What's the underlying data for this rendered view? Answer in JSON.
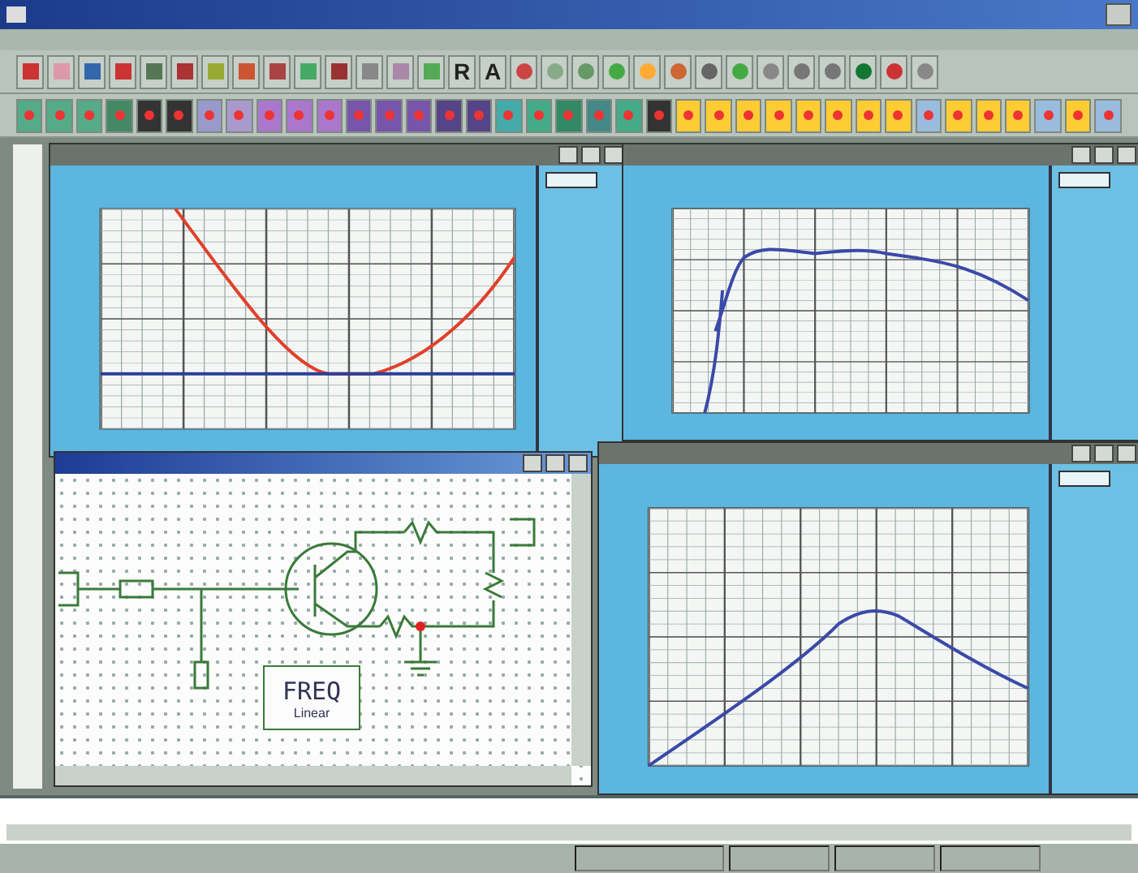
{
  "toolbar": {
    "letters": [
      {
        "label": "R"
      },
      {
        "label": "A"
      }
    ]
  },
  "windows": [
    {
      "kind": "graph",
      "active": false
    },
    {
      "kind": "graph",
      "active": false
    },
    {
      "kind": "schematic",
      "active": true,
      "block": {
        "title": "FREQ",
        "subtitle": "Linear"
      }
    },
    {
      "kind": "graph",
      "active": false
    }
  ]
}
